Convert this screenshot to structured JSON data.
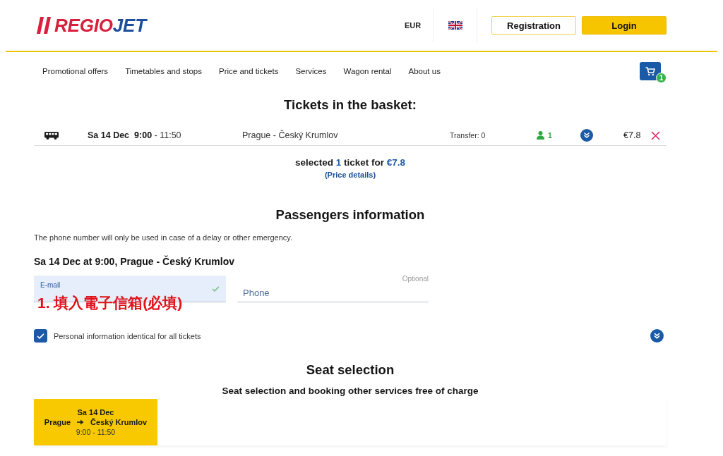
{
  "header": {
    "logo": {
      "part_1": "REGIO",
      "part_2": "JET"
    },
    "currency": "EUR",
    "buttons": [
      {
        "label": "Registration",
        "kind": "outline"
      },
      {
        "label": "Login",
        "kind": "primary"
      }
    ]
  },
  "nav": {
    "items": [
      "Promotional offers",
      "Timetables and stops",
      "Price and tickets",
      "Services",
      "Wagon rental",
      "About us"
    ],
    "cart_count": "1"
  },
  "basket": {
    "title": "Tickets in the basket:",
    "tickets": [
      {
        "date": "Sa 14 Dec",
        "times": "**9:00** - 11:50",
        "route": "Prague - Český Krumlov",
        "transfer": "Transfer: 0",
        "passengers": "1",
        "price": "€7.8"
      }
    ],
    "summary": {
      "prefix": "selected",
      "count": "1",
      "middle": "ticket for",
      "total": "€7.8"
    },
    "price_details": "(Price details)"
  },
  "passengers": {
    "title": "Passengers information",
    "note": "The phone number will only be used in case of a delay or other emergency.",
    "trip": "Sa 14 Dec at 9:00, Prague - Český Krumlov",
    "fields": [
      {
        "kind": "email",
        "label": "E-mail",
        "valid": true
      },
      {
        "kind": "phone",
        "placeholder": "Phone",
        "hint": "Optional"
      }
    ],
    "annotation": "1. 填入電子信箱(必填)",
    "checkbox": {
      "label": "Personal information identical for all tickets",
      "checked": true
    }
  },
  "seats": {
    "title": "Seat selection",
    "subtitle": "Seat selection and booking other services free of charge",
    "segments": [
      {
        "date": "Sa 14 Dec",
        "from": "Prague",
        "to": "Český Krumlov",
        "times": "9:00 - 11:50",
        "selected": true
      }
    ]
  }
}
